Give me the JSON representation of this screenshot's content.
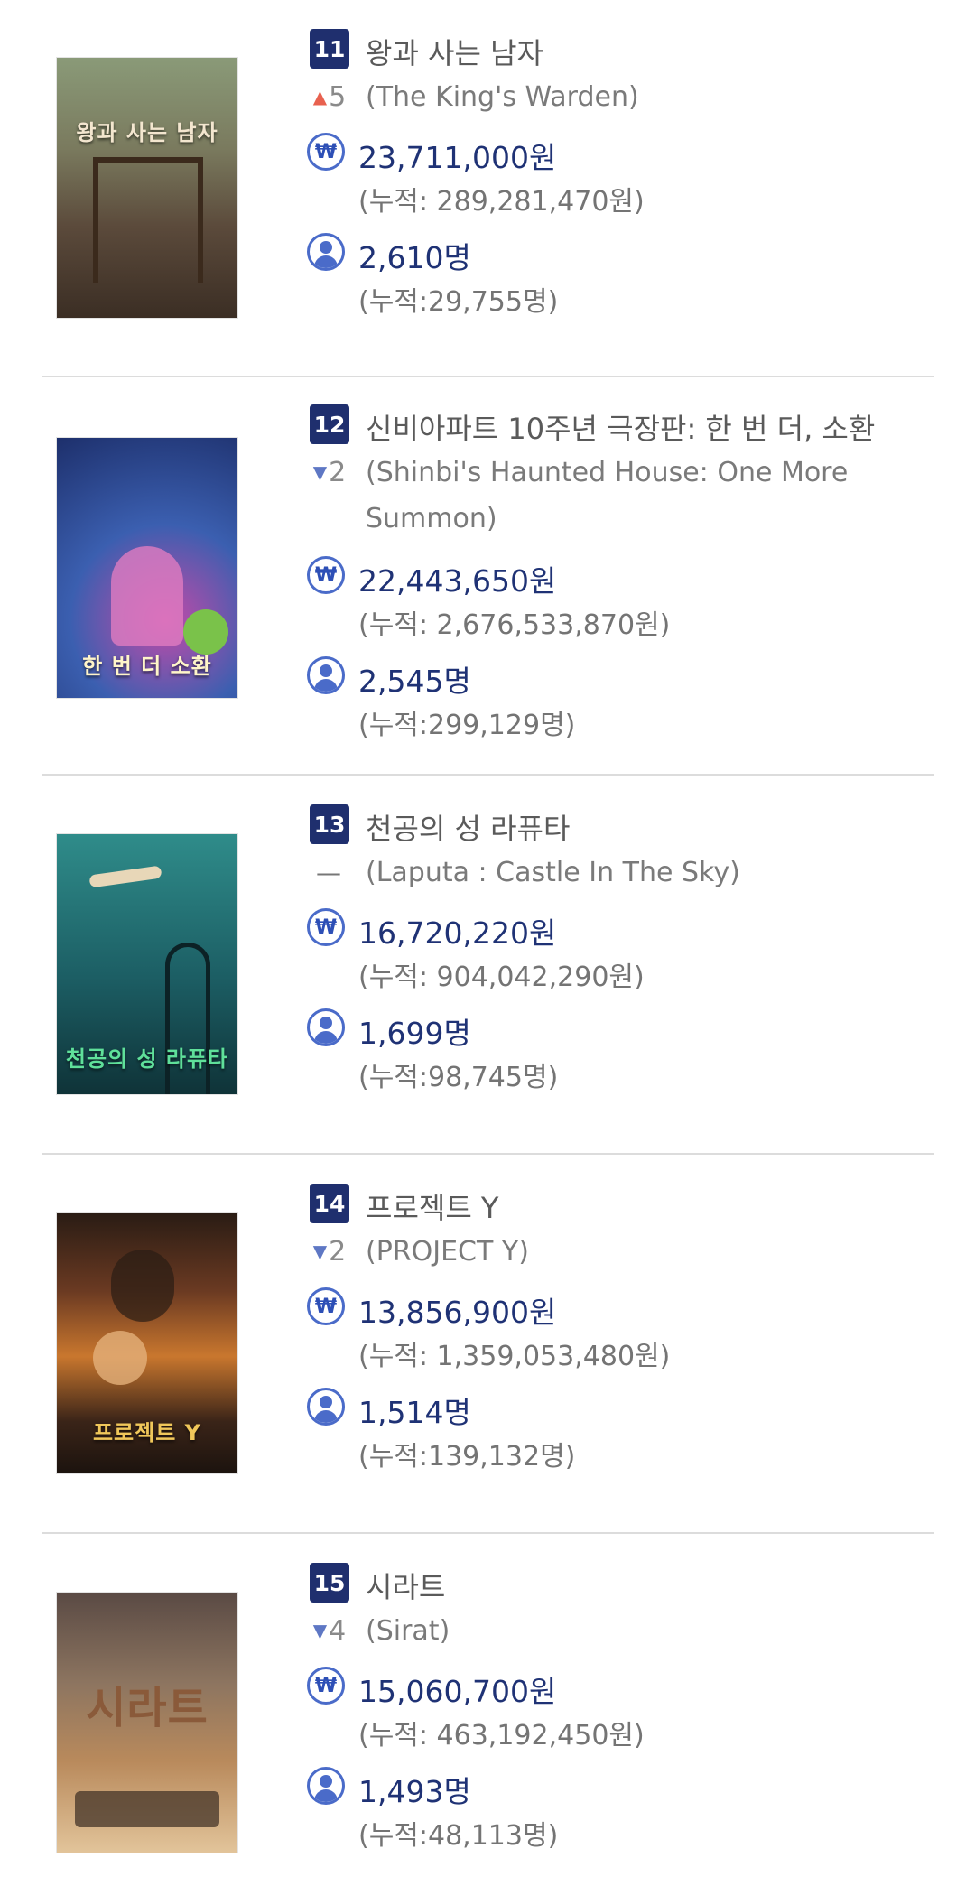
{
  "movies": [
    {
      "rank": "11",
      "title_ko": "왕과 사는 남자",
      "change": {
        "direction": "up",
        "value": "5"
      },
      "title_en": "(The King's Warden)",
      "sales": "23,711,000원",
      "sales_cumulative": "(누적: 289,281,470원)",
      "audience": "2,610명",
      "audience_cumulative": "(누적:29,755명)",
      "poster": {
        "text": "왕과 사는 남자",
        "colors": [
          "#8a9a78",
          "#5b4a3b",
          "#3b2e24"
        ]
      }
    },
    {
      "rank": "12",
      "title_ko": "신비아파트 10주년 극장판: 한 번 더, 소환",
      "change": {
        "direction": "down",
        "value": "2"
      },
      "title_en": "(Shinbi's Haunted House: One More Summon)",
      "sales": "22,443,650원",
      "sales_cumulative": "(누적: 2,676,533,870원)",
      "audience": "2,545명",
      "audience_cumulative": "(누적:299,129명)",
      "poster": {
        "text": "한 번 더 소환",
        "colors": [
          "#1d2f6b",
          "#3b5fb0",
          "#c44aa8"
        ]
      }
    },
    {
      "rank": "13",
      "title_ko": "천공의 성 라퓨타",
      "change": {
        "direction": "none",
        "value": ""
      },
      "title_en": "(Laputa : Castle In The Sky)",
      "sales": "16,720,220원",
      "sales_cumulative": "(누적: 904,042,290원)",
      "audience": "1,699명",
      "audience_cumulative": "(누적:98,745명)",
      "poster": {
        "text": "천공의 성 라퓨타",
        "colors": [
          "#2f8c8a",
          "#1c5e64",
          "#0f3338"
        ]
      }
    },
    {
      "rank": "14",
      "title_ko": "프로젝트 Y",
      "change": {
        "direction": "down",
        "value": "2"
      },
      "title_en": "(PROJECT Y)",
      "sales": "13,856,900원",
      "sales_cumulative": "(누적: 1,359,053,480원)",
      "audience": "1,514명",
      "audience_cumulative": "(누적:139,132명)",
      "poster": {
        "text": "프로젝트 Y",
        "colors": [
          "#6b3a22",
          "#c9772e",
          "#2a1c14"
        ]
      }
    },
    {
      "rank": "15",
      "title_ko": "시라트",
      "change": {
        "direction": "down",
        "value": "4"
      },
      "title_en": "(Sirat)",
      "sales": "15,060,700원",
      "sales_cumulative": "(누적: 463,192,450원)",
      "audience": "1,493명",
      "audience_cumulative": "(누적:48,113명)",
      "poster": {
        "text": "시라트",
        "colors": [
          "#5a4a44",
          "#b98a5c",
          "#e2c49a"
        ]
      }
    }
  ]
}
